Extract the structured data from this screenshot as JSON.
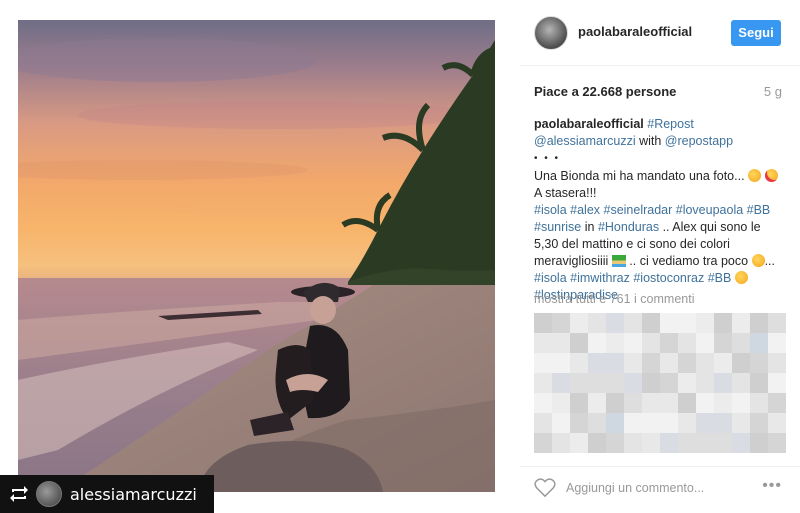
{
  "post": {
    "repost_badge": {
      "username": "alessiamarcuzzi",
      "icon": "repost-icon"
    }
  },
  "header": {
    "username": "paolabaraleofficial",
    "follow_label": "Segui"
  },
  "stats": {
    "likes_text": "Piace a 22.668 persone",
    "time_ago": "5 g"
  },
  "caption": {
    "username": "paolabaraleofficial",
    "tag_repost": "#Repost",
    "mention_1": "@alessiamarcuzzi",
    "text_with": " with ",
    "mention_2": "@repostapp",
    "line_dots": "• • •",
    "line_1": "Una Bionda mi ha mandato una foto...",
    "line_2": "A stasera!!!",
    "tags_1": "#isola #alex #seinelradar #loveupaola #BB #sunrise",
    "text_in": " in ",
    "tag_honduras": "#Honduras",
    "text_2": " .. Alex qui sono le 5,30 del mattino e ci sono dei colori meravigliosiiii ",
    "text_3": " .. ci vediamo tra poco ",
    "text_4": "...",
    "tags_2": "#isola #imwithraz #iostoconraz #BB",
    "tags_3": "#lostinparadise"
  },
  "comments": {
    "view_all_text": "mostra tutti e 761 i commenti"
  },
  "footer": {
    "comment_placeholder": "Aggiungi un commento...",
    "more_label": "•••"
  },
  "colors": {
    "accent": "#3897f0",
    "hashtag": "#3f729b",
    "muted": "#999999"
  }
}
